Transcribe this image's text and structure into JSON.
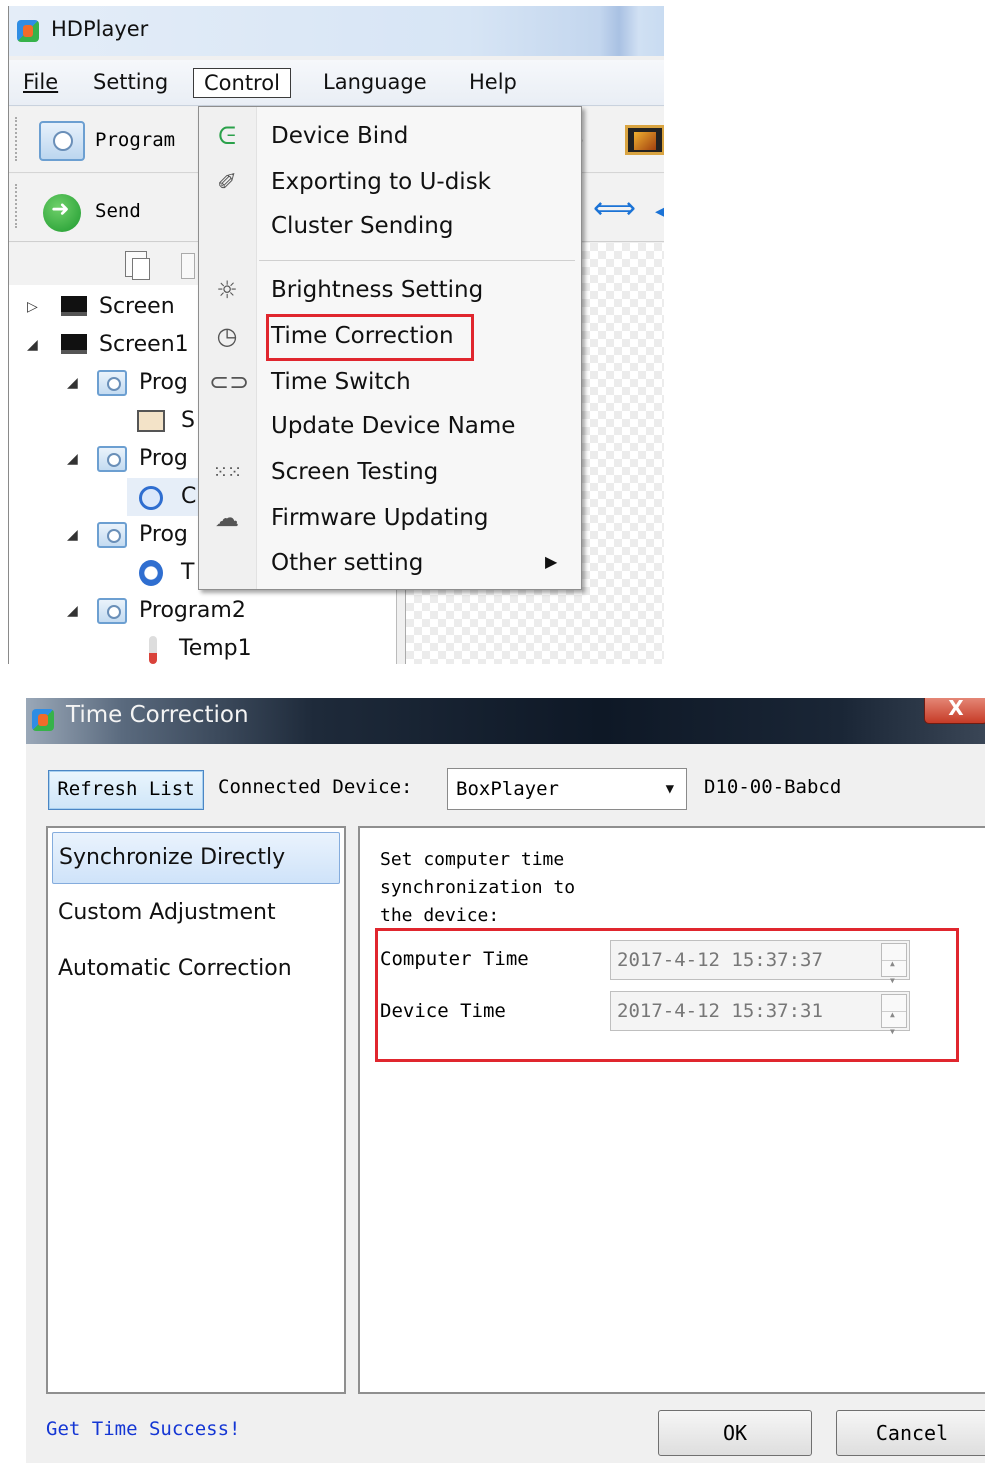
{
  "main_window": {
    "title": "HDPlayer",
    "menubar": [
      "File",
      "Setting",
      "Control",
      "Language",
      "Help"
    ],
    "toolbar": {
      "program_label": "Program",
      "send_label": "Send"
    },
    "tree": [
      {
        "label": "Screen",
        "level": 0
      },
      {
        "label": "Screen1",
        "level": 0
      },
      {
        "label": "Prog",
        "level": 1
      },
      {
        "label": "S",
        "level": 2
      },
      {
        "label": "Prog",
        "level": 1
      },
      {
        "label": "C",
        "level": 2
      },
      {
        "label": "Prog",
        "level": 1
      },
      {
        "label": "T",
        "level": 2
      },
      {
        "label": "Program2",
        "level": 1
      },
      {
        "label": "Temp1",
        "level": 2
      }
    ]
  },
  "control_menu": {
    "items": [
      {
        "label": "Device Bind",
        "icon": "magnet-icon"
      },
      {
        "label": "Exporting to U-disk",
        "icon": "usb-icon"
      },
      {
        "label": "Cluster Sending",
        "icon": ""
      },
      {
        "label": "Brightness Setting",
        "icon": "bulb-icon"
      },
      {
        "label": "Time Correction",
        "icon": "clock-icon",
        "highlighted": true
      },
      {
        "label": "Time Switch",
        "icon": "switch-icon"
      },
      {
        "label": "Update Device Name",
        "icon": ""
      },
      {
        "label": "Screen Testing",
        "icon": "grid-dots-icon"
      },
      {
        "label": "Firmware Updating",
        "icon": "cloud-icon"
      },
      {
        "label": "Other setting",
        "icon": "",
        "submenu": true
      }
    ],
    "highlight_color": "#e0262e"
  },
  "dialog": {
    "title": "Time Correction",
    "close_label": "X",
    "refresh_label": "Refresh List",
    "connected_label": "Connected Device:",
    "device_selected": "BoxPlayer",
    "device_id": "D10-00-Babcd",
    "modes": [
      "Synchronize Directly",
      "Custom Adjustment",
      "Automatic Correction"
    ],
    "selected_mode": "Synchronize Directly",
    "description_lines": [
      "Set computer time",
      "synchronization to",
      "the device:"
    ],
    "computer_time_label": "Computer Time",
    "computer_time_value": "2017-4-12 15:37:37",
    "device_time_label": "Device Time",
    "device_time_value": "2017-4-12 15:37:31",
    "status": "Get Time Success!",
    "status_color": "#1436d4",
    "ok_label": "OK",
    "cancel_label": "Cancel"
  }
}
